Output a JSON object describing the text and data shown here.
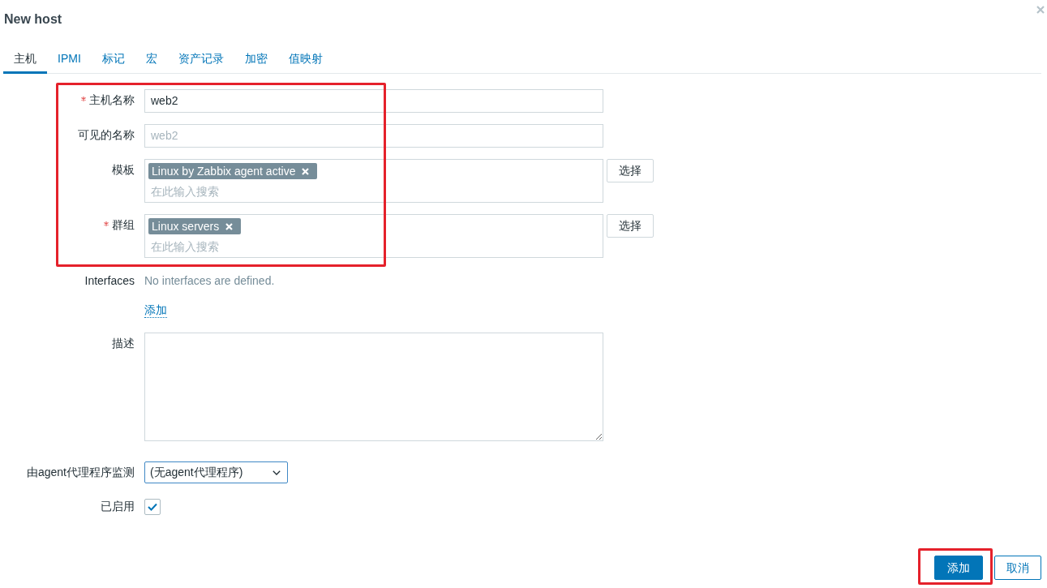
{
  "dialog": {
    "title": "New host"
  },
  "tabs": [
    {
      "label": "主机",
      "selected": true
    },
    {
      "label": "IPMI",
      "selected": false
    },
    {
      "label": "标记",
      "selected": false
    },
    {
      "label": "宏",
      "selected": false
    },
    {
      "label": "资产记录",
      "selected": false
    },
    {
      "label": "加密",
      "selected": false
    },
    {
      "label": "值映射",
      "selected": false
    }
  ],
  "form": {
    "fields": [
      {
        "kind": "text",
        "label": "主机名称",
        "required": true,
        "value": "web2",
        "highlighted": true
      },
      {
        "kind": "text",
        "label": "可见的名称",
        "required": false,
        "placeholder": "web2",
        "highlighted": true
      },
      {
        "kind": "multiselect",
        "label": "模板",
        "required": false,
        "tags": [
          "Linux by Zabbix agent active"
        ],
        "placeholder": "在此输入搜索",
        "button": "选择",
        "highlighted": true
      },
      {
        "kind": "multiselect",
        "label": "群组",
        "required": true,
        "tags": [
          "Linux servers"
        ],
        "placeholder": "在此输入搜索",
        "button": "选择",
        "highlighted": true
      },
      {
        "kind": "info",
        "label": "Interfaces",
        "required": false,
        "text": "No interfaces are defined.",
        "link": "添加",
        "highlighted": false
      },
      {
        "kind": "textarea",
        "label": "描述",
        "required": false,
        "highlighted": false
      },
      {
        "kind": "select",
        "label": "由agent代理程序监测",
        "required": false,
        "value": "(无agent代理程序)",
        "highlighted": false
      },
      {
        "kind": "checkbox",
        "label": "已启用",
        "required": false,
        "checked": true,
        "highlighted": false
      }
    ]
  },
  "buttons": [
    {
      "label": "添加",
      "primary": true,
      "highlighted": true
    },
    {
      "label": "取消",
      "primary": false,
      "highlighted": false
    }
  ]
}
